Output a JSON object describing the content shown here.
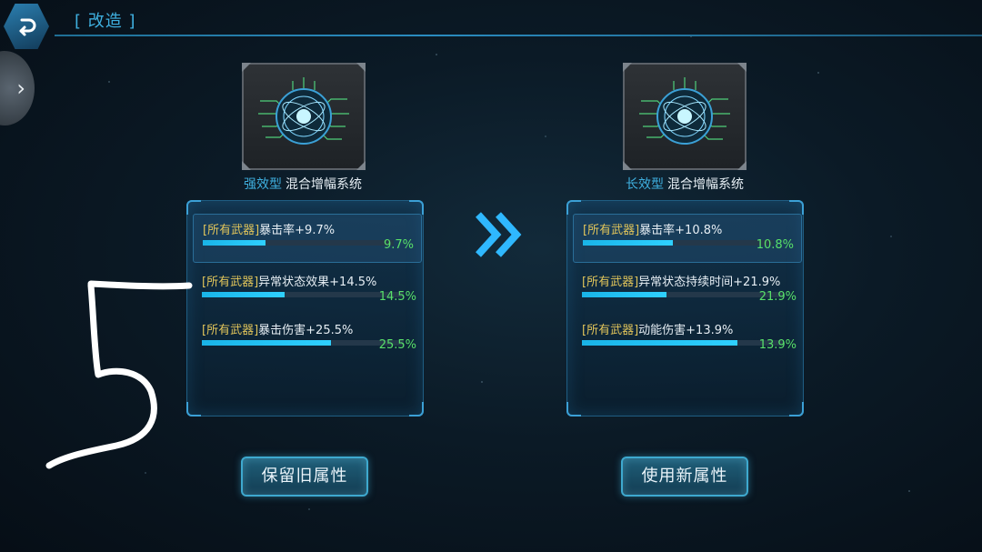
{
  "header": {
    "title": "[ 改造 ]"
  },
  "left": {
    "item_type": "强效型",
    "item_name": "混合增幅系统",
    "stats": [
      {
        "tag": "[所有武器]",
        "text": "暴击率+9.7%",
        "value": "9.7%",
        "fill_fraction": 0.33
      },
      {
        "tag": "[所有武器]",
        "text": "异常状态效果+14.5%",
        "value": "14.5%",
        "fill_fraction": 0.41
      },
      {
        "tag": "[所有武器]",
        "text": "暴击伤害+25.5%",
        "value": "25.5%",
        "fill_fraction": 0.64
      }
    ],
    "button_label": "保留旧属性"
  },
  "right": {
    "item_type": "长效型",
    "item_name": "混合增幅系统",
    "stats": [
      {
        "tag": "[所有武器]",
        "text": "暴击率+10.8%",
        "value": "10.8%",
        "fill_fraction": 0.47
      },
      {
        "tag": "[所有武器]",
        "text": "异常状态持续时间+21.9%",
        "value": "21.9%",
        "fill_fraction": 0.42
      },
      {
        "tag": "[所有武器]",
        "text": "动能伤害+13.9%",
        "value": "13.9%",
        "fill_fraction": 0.77
      }
    ],
    "button_label": "使用新属性"
  },
  "colors": {
    "accent": "#3fb0e0",
    "value_green": "#58e06a",
    "tag_yellow": "#e0c45a",
    "bar_fill": "#19b4e8"
  },
  "icons": [
    "back-icon",
    "chevron-right-icon",
    "double-chevron-icon",
    "circuit-core-icon"
  ]
}
